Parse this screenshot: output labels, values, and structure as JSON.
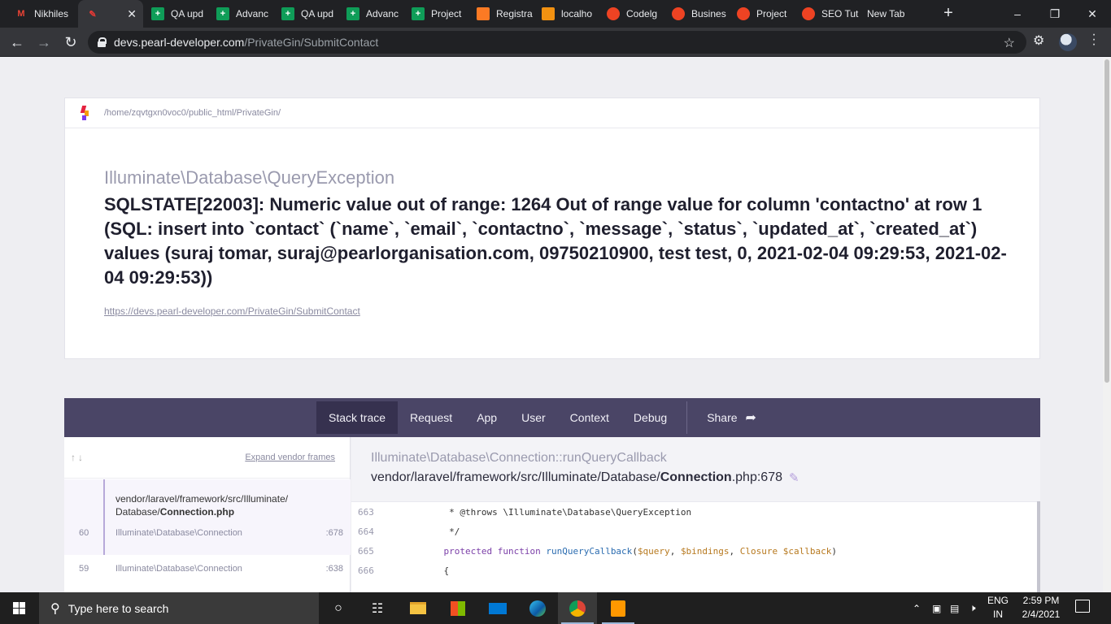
{
  "browser": {
    "tabs": [
      {
        "title": "Nikhiles",
        "icon": "gmail-icon",
        "color": "#ea4335"
      },
      {
        "title": "",
        "icon": "pen-icon",
        "color": "#e53935",
        "active": true
      },
      {
        "title": "QA upd",
        "icon": "sheets-icon",
        "color": "#0f9d58"
      },
      {
        "title": "Advanc",
        "icon": "sheets-icon",
        "color": "#0f9d58"
      },
      {
        "title": "QA upd",
        "icon": "sheets-icon",
        "color": "#0f9d58"
      },
      {
        "title": "Advanc",
        "icon": "sheets-icon",
        "color": "#0f9d58"
      },
      {
        "title": "Project",
        "icon": "sheets-icon",
        "color": "#0f9d58"
      },
      {
        "title": "Registra",
        "icon": "xampp-icon",
        "color": "#fb7a24"
      },
      {
        "title": "localho",
        "icon": "phpmyadmin-icon",
        "color": "#f29111"
      },
      {
        "title": "Codelg",
        "icon": "codeigniter-icon",
        "color": "#ee4323"
      },
      {
        "title": "Busines",
        "icon": "codeigniter-icon",
        "color": "#ee4323"
      },
      {
        "title": "Project",
        "icon": "codeigniter-icon",
        "color": "#ee4323"
      },
      {
        "title": "SEO Tut",
        "icon": "codeigniter-icon",
        "color": "#ee4323"
      },
      {
        "title": "New Tab",
        "icon": "",
        "color": ""
      }
    ],
    "url_host": "devs.pearl-developer.com",
    "url_path": "/PrivateGin/SubmitContact"
  },
  "error": {
    "app_path": "/home/zqvtgxn0voc0/public_html/PrivateGin/",
    "exception_class": "Illuminate\\Database\\QueryException",
    "message": "SQLSTATE[22003]: Numeric value out of range: 1264 Out of range value for column 'contactno' at row 1 (SQL: insert into `contact` (`name`, `email`, `contactno`, `message`, `status`, `updated_at`, `created_at`) values (suraj tomar, suraj@pearlorganisation.com, 09750210900, test test, 0, 2021-02-04 09:29:53, 2021-02-04 09:29:53))",
    "url": "https://devs.pearl-developer.com/PrivateGin/SubmitContact"
  },
  "nav_tabs": [
    "Stack trace",
    "Request",
    "App",
    "User",
    "Context",
    "Debug"
  ],
  "share_label": "Share",
  "stack": {
    "expand_label": "Expand vendor frames",
    "active_file_line1": "vendor/laravel/framework/src/Illuminate/",
    "active_file_dir": "Database/",
    "active_file_name": "Connection.php",
    "frames": [
      {
        "number": "60",
        "class": "Illuminate\\Database\\Connection",
        "line": ":678"
      },
      {
        "number": "59",
        "class": "Illuminate\\Database\\Connection",
        "line": ":638"
      }
    ]
  },
  "code": {
    "method": "Illuminate\\Database\\Connection::runQueryCallback",
    "file_dir": "vendor/laravel/framework/src/Illuminate/Database/",
    "file_name": "Connection",
    "file_ext": ".php:678",
    "lines": [
      {
        "no": "663",
        "text": "     * @throws \\Illuminate\\Database\\QueryException"
      },
      {
        "no": "664",
        "text": "     */"
      },
      {
        "no": "665",
        "text": ""
      },
      {
        "no": "666",
        "text": "    {"
      }
    ],
    "line_665_keyword": "protected function ",
    "line_665_fn": "runQueryCallback",
    "line_665_args_a": "(",
    "line_665_v1": "$query",
    "line_665_sep1": ", ",
    "line_665_v2": "$bindings",
    "line_665_sep2": ", ",
    "line_665_type": "Closure ",
    "line_665_v3": "$callback",
    "line_665_end": ")"
  },
  "taskbar": {
    "search_placeholder": "Type here to search",
    "lang": "ENG",
    "region": "IN",
    "time": "2:59 PM",
    "date": "2/4/2021"
  }
}
